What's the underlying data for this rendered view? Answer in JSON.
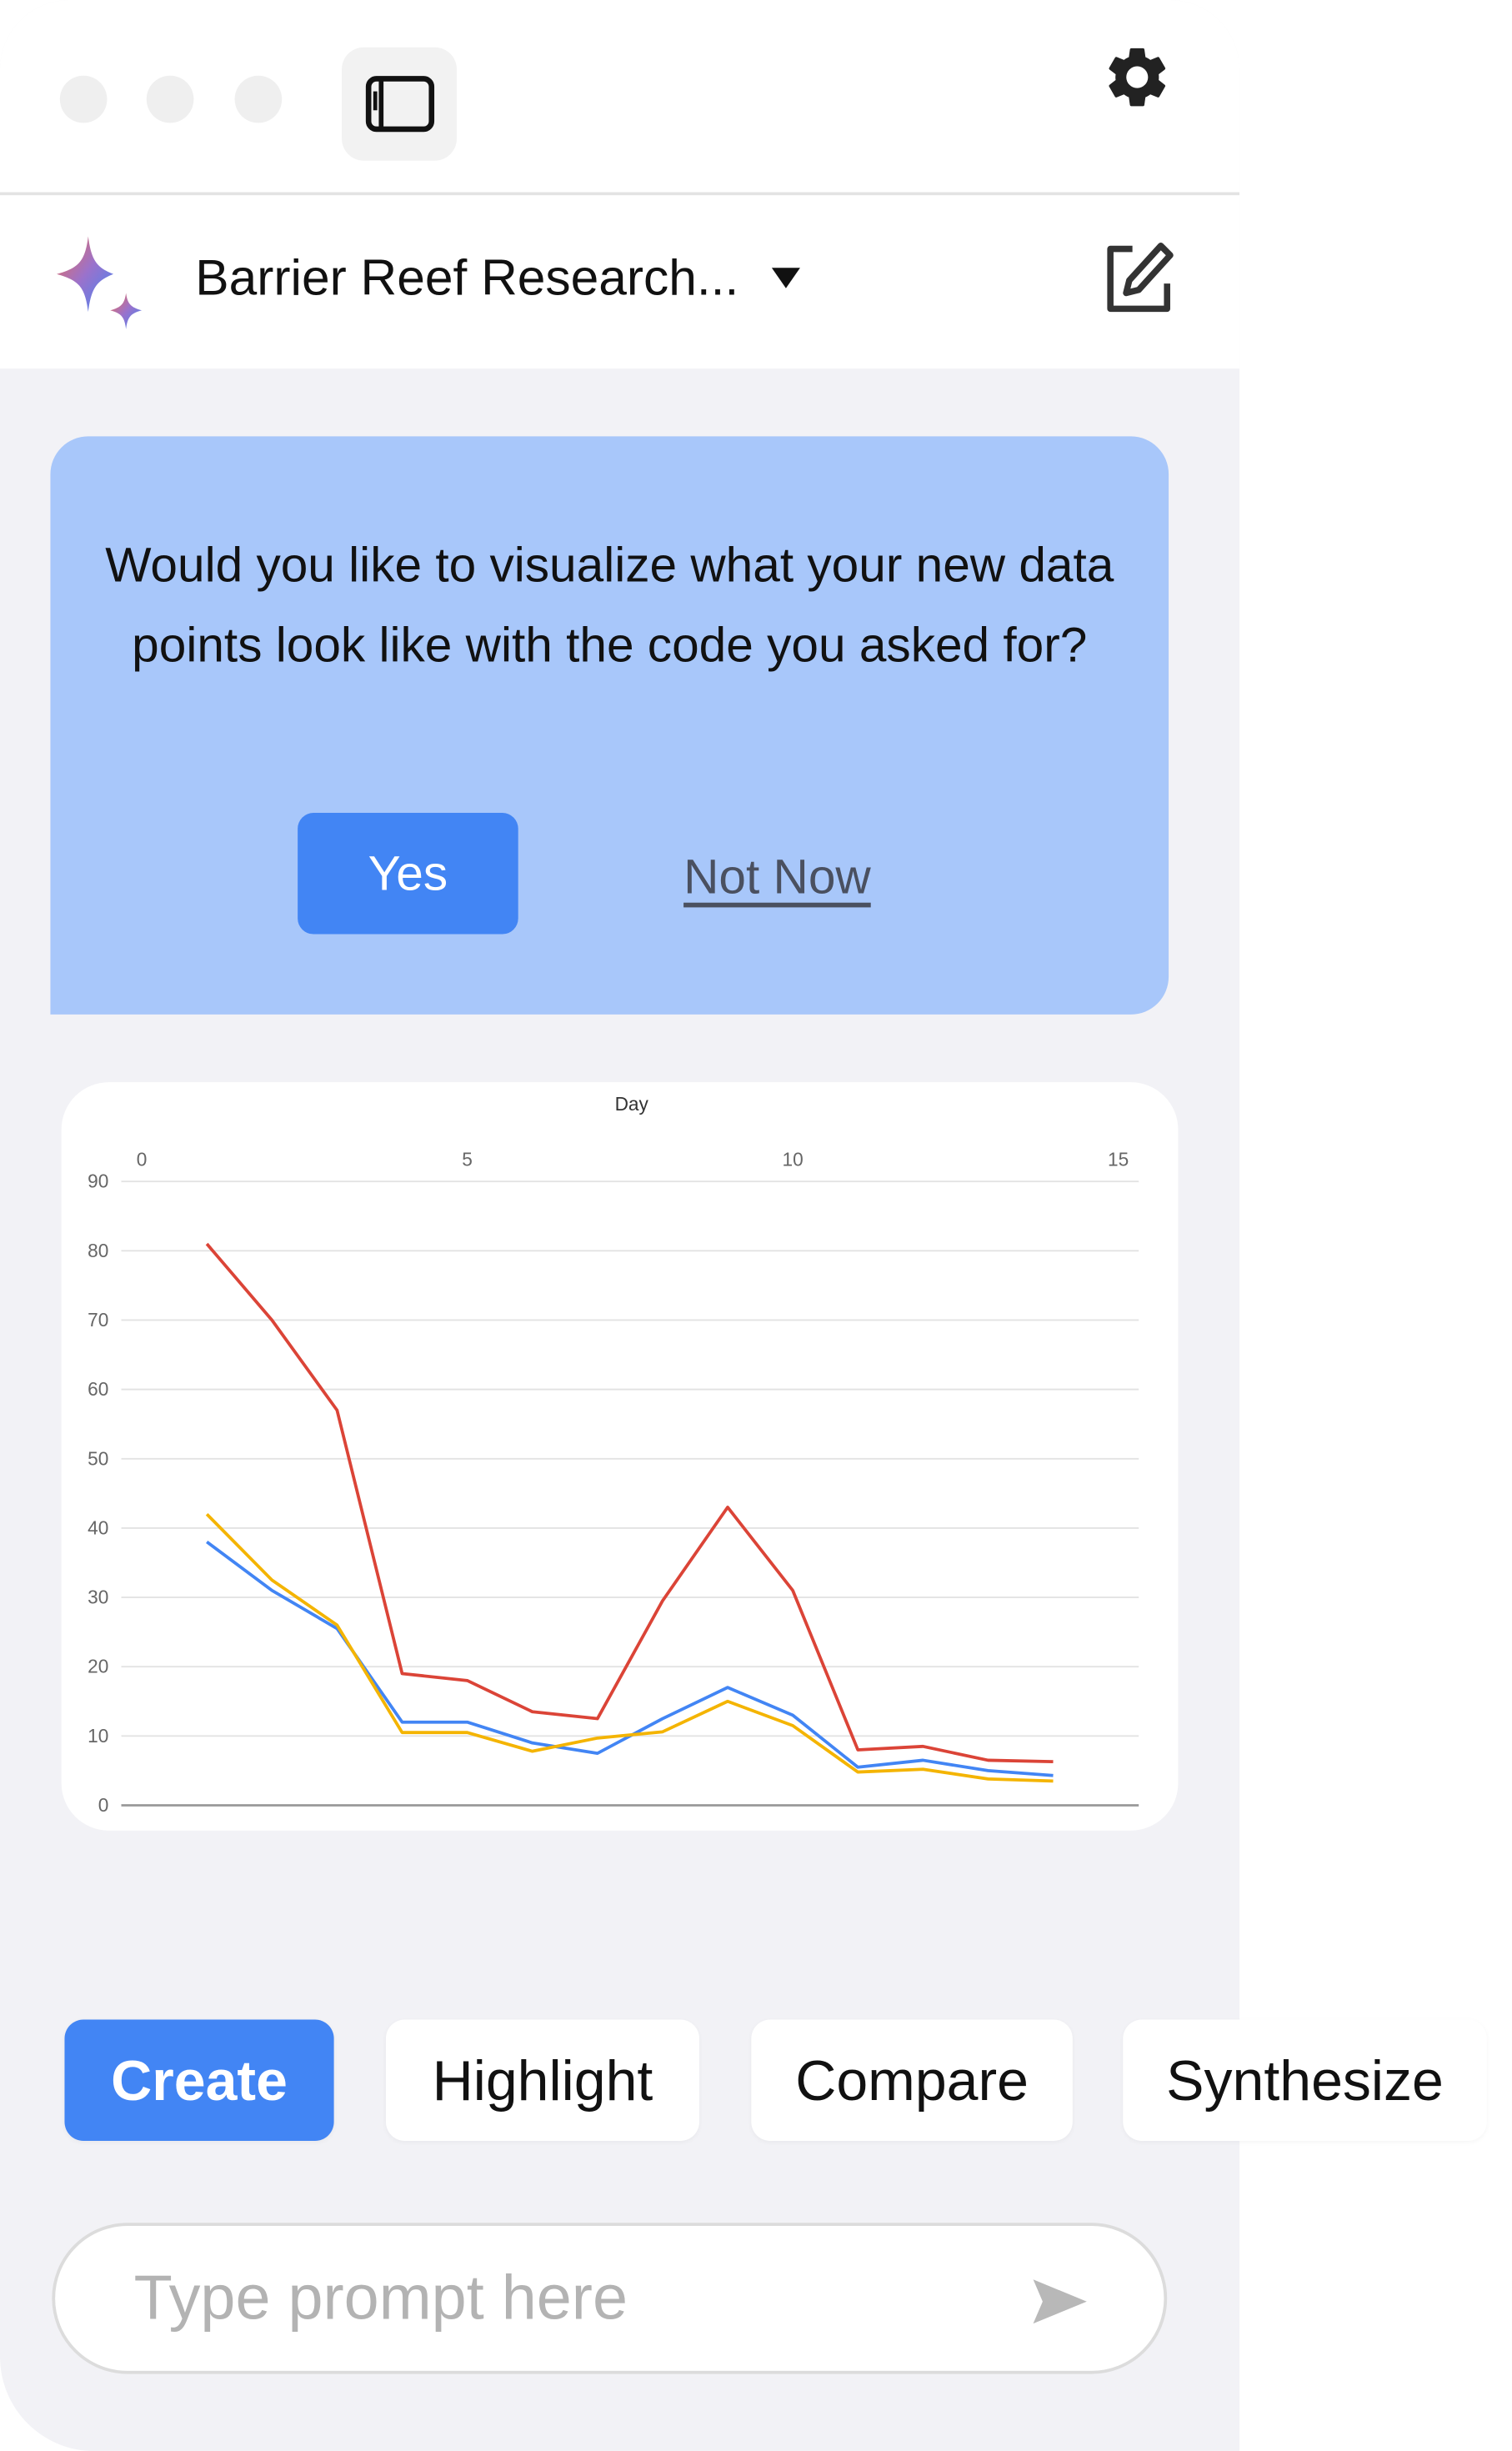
{
  "window": {
    "icons": [
      "sidebar-toggle-icon",
      "gear-icon",
      "sparkle-logo-icon",
      "edit-icon",
      "send-icon"
    ]
  },
  "header": {
    "title": "Barrier Reef Research..."
  },
  "prompt_card": {
    "question": "Would you like to visualize what your new data points look like with the code you asked for?",
    "yes_label": "Yes",
    "not_now_label": "Not Now",
    "background": "#a8c7fa",
    "accent": "#4285f4"
  },
  "chart_data": {
    "type": "line",
    "xlabel": "Day",
    "xlabel_position": "top",
    "xlim": [
      0,
      15
    ],
    "ylim": [
      0,
      90
    ],
    "xticks": [
      "0",
      "5",
      "10",
      "15"
    ],
    "yticks": [
      "0",
      "10",
      "20",
      "30",
      "40",
      "50",
      "60",
      "70",
      "80",
      "90"
    ],
    "grid": true,
    "x": [
      1,
      2,
      3,
      4,
      5,
      6,
      7,
      8,
      9,
      10,
      11,
      12,
      13,
      14
    ],
    "series": [
      {
        "color": "#db4437",
        "values": [
          81,
          70,
          57,
          19,
          18,
          13.5,
          12.5,
          29.5,
          43,
          31,
          8,
          8.5,
          6.5,
          6.3
        ]
      },
      {
        "color": "#4285f4",
        "values": [
          38,
          31,
          25.5,
          12,
          12,
          9,
          7.5,
          12.5,
          17,
          13,
          5.5,
          6.5,
          5,
          4.3
        ]
      },
      {
        "color": "#f4b400",
        "values": [
          42,
          32.5,
          26,
          10.5,
          10.5,
          7.8,
          9.7,
          10.6,
          15,
          11.5,
          4.8,
          5.2,
          3.8,
          3.5
        ]
      }
    ]
  },
  "chips": [
    {
      "label": "Create",
      "active": true
    },
    {
      "label": "Highlight",
      "active": false
    },
    {
      "label": "Compare",
      "active": false
    },
    {
      "label": "Synthesize",
      "active": false
    }
  ],
  "input": {
    "placeholder": "Type prompt here"
  }
}
